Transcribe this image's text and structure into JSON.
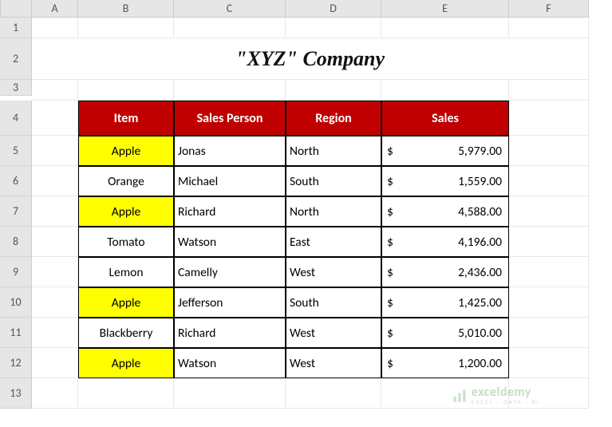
{
  "columns": [
    "",
    "A",
    "B",
    "C",
    "D",
    "E",
    "F"
  ],
  "rows": [
    "1",
    "2",
    "3",
    "4",
    "5",
    "6",
    "7",
    "8",
    "9",
    "10",
    "11",
    "12",
    "13"
  ],
  "title": "\"XYZ\" Company",
  "headers": {
    "item": "Item",
    "salesPerson": "Sales Person",
    "region": "Region",
    "sales": "Sales"
  },
  "currency": "$",
  "data": [
    {
      "item": "Apple",
      "hl": true,
      "salesPerson": "Jonas",
      "region": "North",
      "sales": "5,979.00"
    },
    {
      "item": "Orange",
      "hl": false,
      "salesPerson": "Michael",
      "region": "South",
      "sales": "1,559.00"
    },
    {
      "item": "Apple",
      "hl": true,
      "salesPerson": "Richard",
      "region": "North",
      "sales": "4,588.00"
    },
    {
      "item": "Tomato",
      "hl": false,
      "salesPerson": "Watson",
      "region": "East",
      "sales": "4,196.00"
    },
    {
      "item": "Lemon",
      "hl": false,
      "salesPerson": "Camelly",
      "region": "West",
      "sales": "2,436.00"
    },
    {
      "item": "Apple",
      "hl": true,
      "salesPerson": "Jefferson",
      "region": "South",
      "sales": "1,425.00"
    },
    {
      "item": "Blackberry",
      "hl": false,
      "salesPerson": "Richard",
      "region": "West",
      "sales": "5,010.00"
    },
    {
      "item": "Apple",
      "hl": true,
      "salesPerson": "Watson",
      "region": "West",
      "sales": "1,200.00"
    }
  ],
  "watermark": {
    "name": "exceldemy",
    "tagline": "EXCEL · DATA · BI"
  }
}
